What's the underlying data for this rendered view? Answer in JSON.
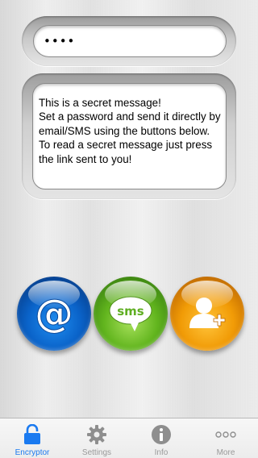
{
  "password": {
    "value": "••••"
  },
  "message": {
    "text": "This is a secret message!\nSet a password and send it directly by email/SMS using the buttons below. To read a secret message just press the link sent to you!"
  },
  "actions": {
    "email_icon": "at-icon",
    "sms_icon": "sms-bubble-icon",
    "sms_label": "sms",
    "contact_icon": "add-contact-icon"
  },
  "tabs": [
    {
      "label": "Encryptor",
      "icon": "lock-icon",
      "active": true
    },
    {
      "label": "Settings",
      "icon": "gear-icon",
      "active": false
    },
    {
      "label": "Info",
      "icon": "info-icon",
      "active": false
    },
    {
      "label": "More",
      "icon": "more-icon",
      "active": false
    }
  ],
  "colors": {
    "accent": "#1a7af0",
    "email": "#0a63c9",
    "sms": "#62b51e",
    "contact": "#f19b06",
    "tab_inactive": "#999999"
  }
}
